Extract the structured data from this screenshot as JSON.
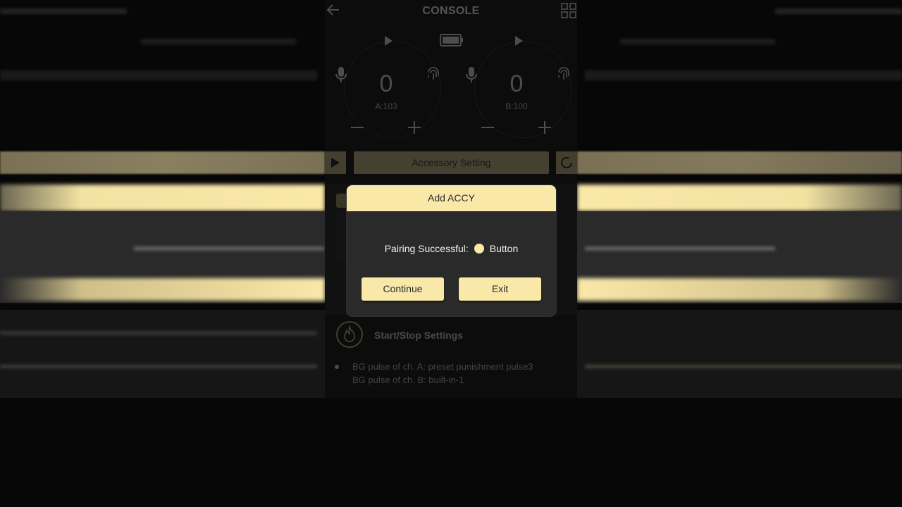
{
  "header": {
    "title": "CONSOLE",
    "back_icon": "arrow-left-icon",
    "menu_icon": "grid-icon"
  },
  "channels": [
    {
      "name": "A",
      "value": "0",
      "sub_label": "A:103"
    },
    {
      "name": "B",
      "value": "0",
      "sub_label": "B:100"
    }
  ],
  "accessory": {
    "label": "Accessory Setting"
  },
  "start_stop": {
    "title": "Start/Stop Settings",
    "lines": [
      "BG pulse of ch. A: preset punishment pulse3",
      "BG pulse of ch. B: built-in-1"
    ]
  },
  "dialog": {
    "title": "Add ACCY",
    "message": "Pairing Successful:",
    "device": "Button",
    "continue_label": "Continue",
    "exit_label": "Exit"
  },
  "colors": {
    "accent": "#f9e8a8",
    "background": "#070707"
  }
}
